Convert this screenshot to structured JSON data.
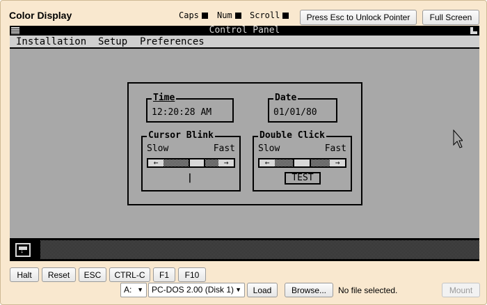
{
  "header": {
    "title": "Color Display",
    "indicators": {
      "caps": "Caps",
      "num": "Num",
      "scroll": "Scroll"
    },
    "unlock_label": "Press Esc to Unlock Pointer",
    "fullscreen_label": "Full Screen"
  },
  "screen": {
    "window_title": "Control Panel",
    "menu": [
      "Installation",
      "Setup",
      "Preferences"
    ],
    "time": {
      "label": "Time",
      "value": "12:20:28 AM"
    },
    "date": {
      "label": "Date",
      "value": "01/01/80"
    },
    "cursor_blink": {
      "label": "Cursor Blink",
      "slow": "Slow",
      "fast": "Fast",
      "left_arrow": "←",
      "right_arrow": "→",
      "preview": "|"
    },
    "double_click": {
      "label": "Double Click",
      "slow": "Slow",
      "fast": "Fast",
      "left_arrow": "←",
      "right_arrow": "→",
      "test_label": "TEST"
    }
  },
  "controls": {
    "buttons": [
      "Halt",
      "Reset",
      "ESC",
      "CTRL-C",
      "F1",
      "F10"
    ],
    "drive": "A:",
    "disk": "PC-DOS 2.00 (Disk 1)",
    "load": "Load",
    "browse": "Browse...",
    "file_status": "No file selected.",
    "mount": "Mount"
  },
  "colors": {
    "frame": "#f9e8cf",
    "screen_gray": "#a8a8a8"
  }
}
